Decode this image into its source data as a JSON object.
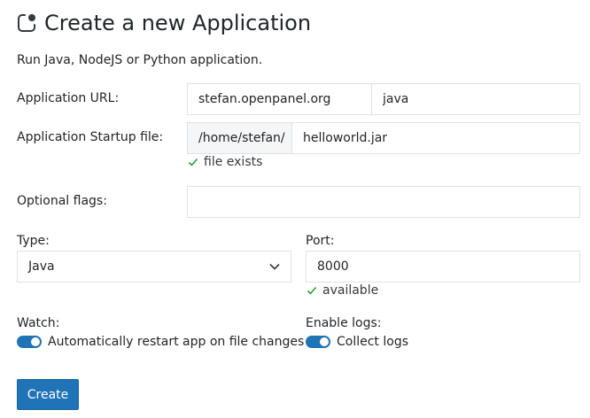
{
  "page": {
    "title": "Create a new Application",
    "subtitle": "Run Java, NodeJS or Python application."
  },
  "form": {
    "url": {
      "label": "Application URL:",
      "domain": "stefan.openpanel.org",
      "path": "java"
    },
    "startup": {
      "label": "Application Startup file:",
      "prefix": "/home/stefan/",
      "file": "helloworld.jar",
      "status": "file exists"
    },
    "flags": {
      "label": "Optional flags:",
      "value": ""
    },
    "type": {
      "label": "Type:",
      "selected": "Java"
    },
    "port": {
      "label": "Port:",
      "value": "8000",
      "status": "available"
    },
    "watch": {
      "label": "Watch:",
      "toggle_label": "Automatically restart app on file changes",
      "enabled": true
    },
    "logs": {
      "label": "Enable logs:",
      "toggle_label": "Collect logs",
      "enabled": true
    },
    "submit_label": "Create"
  },
  "colors": {
    "accent": "#1f73b7",
    "success": "#2e9e3e",
    "border": "#dee2e6",
    "addon_bg": "#f4f6f8"
  },
  "icons": {
    "title": "app-icon",
    "status_ok": "check-icon",
    "select": "chevron-down-icon"
  }
}
